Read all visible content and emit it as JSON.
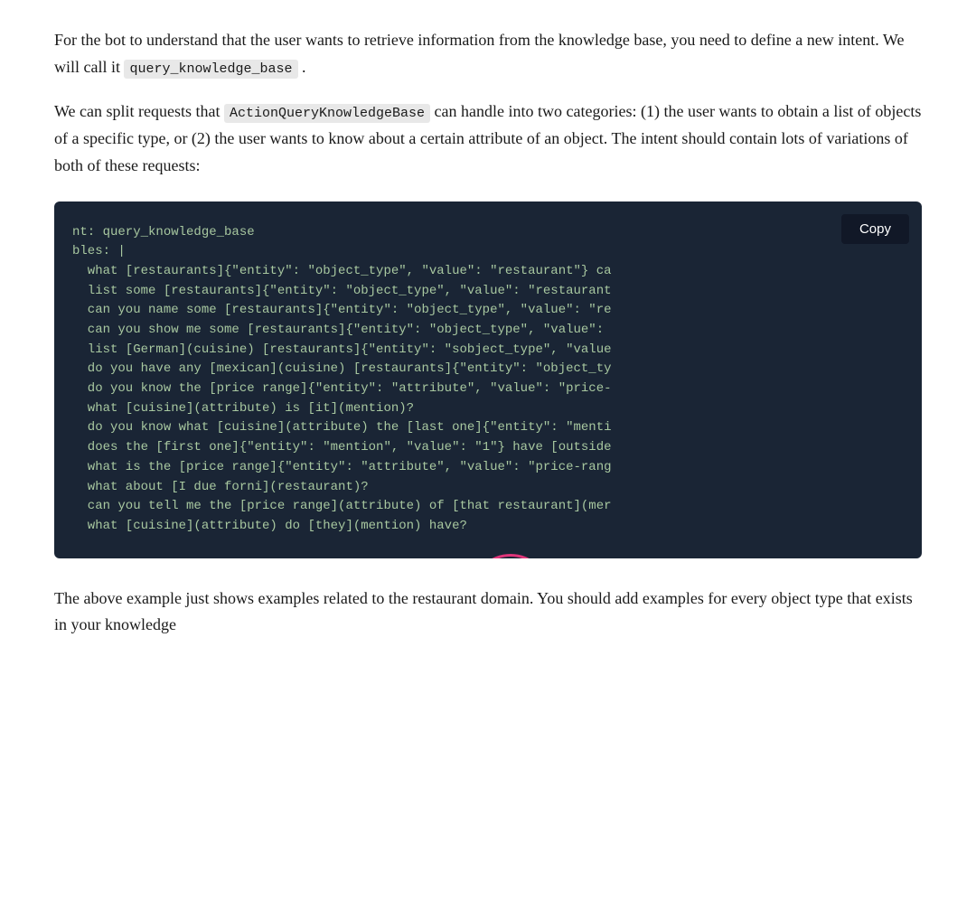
{
  "intro": {
    "paragraph1": "For the bot to understand that the user wants to retrieve information from the knowledge base, you need to define a new intent. We will call it",
    "inline_code1": "query_knowledge_base",
    "paragraph1_end": ".",
    "paragraph2_start": "We can split requests that",
    "inline_code2": "ActionQueryKnowledgeBase",
    "paragraph2_end": "can handle into two categories: (1) the user wants to obtain a list of objects of a specific type, or (2) the user wants to know about a certain attribute of an object. The intent should contain lots of variations of both of these requests:"
  },
  "copy_button_label": "Copy",
  "code_block": {
    "lines": [
      "nt: query_knowledge_base",
      "bles: |",
      "  what [restaurants]{\"entity\": \"object_type\", \"value\": \"restaurant\"} ca",
      "  list some [restaurants]{\"entity\": \"object_type\", \"value\": \"restaurant",
      "  can you name some [restaurants]{\"entity\": \"object_type\", \"value\": \"re",
      "  can you show me some [restaurants]{\"entity\": \"object_type\", \"value\":",
      "  list [German](cuisine) [restaurants]{\"entity\": \"sobject_type\", \"value",
      "  do you have any [mexican](cuisine) [restaurants]{\"entity\": \"object_ty",
      "  do you know the [price range]{\"entity\": \"attribute\", \"value\": \"price-",
      "  what [cuisine](attribute) is [it](mention)?",
      "  do you know what [cuisine](attribute) the [last one]{\"entity\": \"menti",
      "  does the [first one]{\"entity\": \"mention\", \"value\": \"1\"} have [outside",
      "  what is the [price range]{\"entity\": \"attribute\", \"value\": \"price-rang",
      "  what about [I due forni](restaurant)?",
      "  can you tell me the [price range](attribute) of [that restaurant](mer",
      "  what [cuisine](attribute) do [they](mention) have?"
    ]
  },
  "outro": {
    "text": "The above example just shows examples related to the restaurant domain. You should add examples for every object type that exists in your knowledge"
  }
}
